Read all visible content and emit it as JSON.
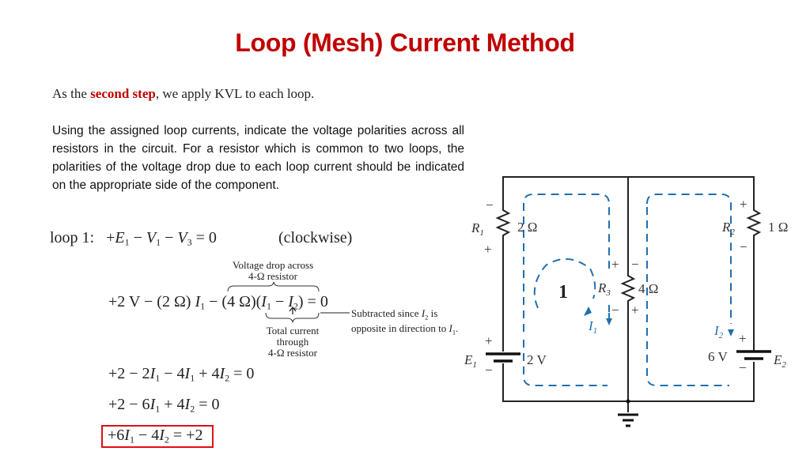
{
  "title": "Loop (Mesh) Current Method",
  "intro": {
    "before": "As the ",
    "highlight": "second step",
    "after": ", we apply KVL to each loop."
  },
  "paragraph": "Using the assigned loop currents, indicate the voltage polarities across all resistors in the circuit. For a resistor which is common to two loops, the polarities of the voltage drop due to each loop current should be indicated on the appropriate side of the component.",
  "colors": {
    "title": "#C00000",
    "highlight": "#C00000",
    "loop_current": "#1F6FB0",
    "result_box": "#E01010"
  },
  "equations": {
    "loop1_label": "loop 1:",
    "loop1_eq": {
      "t1": "+",
      "E": "E",
      "E_sub": "1",
      "t2": " − ",
      "V1": "V",
      "V1_sub": "1",
      "t3": " − ",
      "V3": "V",
      "V3_sub": "3",
      "t4": " = 0"
    },
    "loop1_dir": "(clockwise)",
    "expanded": {
      "a": "+2 V − (2 Ω) ",
      "I1": "I",
      "I1_sub": "1",
      "b": " − (4 Ω)(",
      "c": "I",
      "c_sub": "1",
      "d": " − ",
      "e": "I",
      "e_sub": "2",
      "f": ") = 0"
    },
    "note_top": [
      "Voltage drop across",
      "4-Ω resistor"
    ],
    "note_bottom": [
      "Total current",
      "through",
      "4-Ω resistor"
    ],
    "note_side": {
      "line1_a": "Subtracted since ",
      "line1_I": "I",
      "line1_sub": "2",
      "line1_b": " is",
      "line2_a": "opposite in direction to ",
      "line2_I": "I",
      "line2_sub": "1",
      "line2_b": "."
    },
    "step1": {
      "a": "+2 − 2",
      "I1": "I",
      "s1": "1",
      "b": " − 4",
      "I1b": "I",
      "s1b": "1",
      "c": " + 4",
      "I2": "I",
      "s2": "2",
      "d": " = 0"
    },
    "step2": {
      "a": "+2 − 6",
      "I1": "I",
      "s1": "1",
      "b": " + 4",
      "I2": "I",
      "s2": "2",
      "c": " = 0"
    },
    "result": {
      "a": "+6",
      "I1": "I",
      "s1": "1",
      "b": " − 4",
      "I2": "I",
      "s2": "2",
      "c": " = +2"
    }
  },
  "circuit": {
    "R1": {
      "name": "R",
      "sub": "1",
      "value": "2 Ω",
      "top_sign": "−",
      "bottom_sign": "+"
    },
    "R2": {
      "name": "R",
      "sub": "2",
      "value": "1 Ω",
      "top_sign": "+",
      "bottom_sign": "−"
    },
    "R3": {
      "name": "R",
      "sub": "3",
      "value": "4 Ω",
      "left_top": "+",
      "left_bottom": "−",
      "right_top": "−",
      "right_bottom": "+"
    },
    "E1": {
      "name": "E",
      "sub": "1",
      "value": "2 V",
      "top_sign": "+",
      "bottom_sign": "−"
    },
    "E2": {
      "name": "E",
      "sub": "2",
      "value": "6 V",
      "top_sign": "+",
      "bottom_sign": "−"
    },
    "loop_number": "1",
    "I1": {
      "name": "I",
      "sub": "1"
    },
    "I2": {
      "name": "I",
      "sub": "2"
    }
  }
}
